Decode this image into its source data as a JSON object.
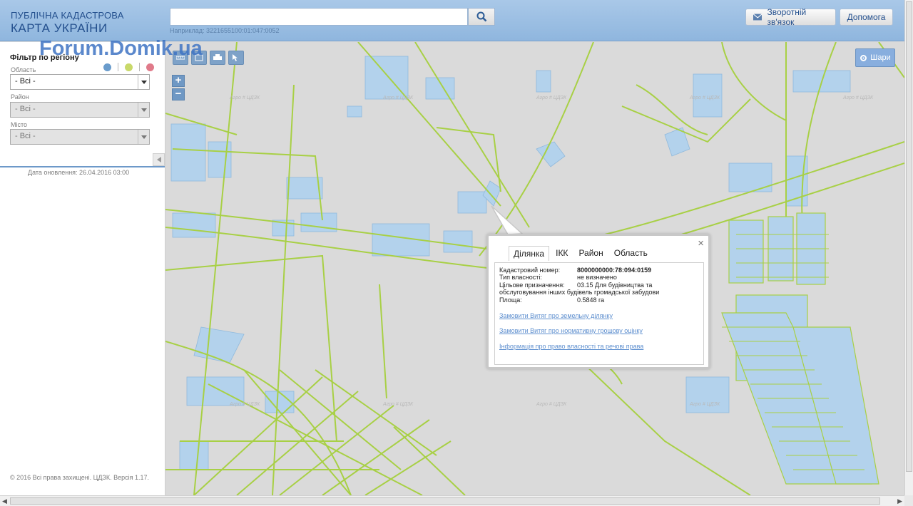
{
  "header": {
    "logo_line1": "ПУБЛІЧНА КАДАСТРОВА",
    "logo_line2": "КАРТА УКРАЇНИ",
    "search_value": "",
    "search_hint": "Наприклад: 3221655100:01:047:0052",
    "feedback_label": "Зворотній зв'язок",
    "help_label": "Допомога"
  },
  "sidebar": {
    "filter_title": "Фільтр по регіону",
    "region_label": "Область",
    "region_value": "- Всі -",
    "district_label": "Район",
    "district_value": "- Всі -",
    "city_label": "Місто",
    "city_value": "- Всі -",
    "update_date": "Дата оновлення: 26.04.2016 03:00",
    "copyright": "© 2016 Всі права захищені. ЦДЗК. Версія 1.17."
  },
  "watermark": "Forum.Domik.ua",
  "map": {
    "layers_label": "Шари",
    "zoom_in": "+",
    "zoom_out": "−",
    "tile_watermark": "Агро # ЦДЗК"
  },
  "popup": {
    "tabs": [
      "Ділянка",
      "ІКК",
      "Район",
      "Область"
    ],
    "active_tab": "Ділянка",
    "rows": [
      {
        "label": "Кадастровий номер:",
        "value": "8000000000:78:094:0159"
      },
      {
        "label": "Тип власності:",
        "value": "не визначено"
      },
      {
        "label": "Цільове призначення:",
        "value": "03.15 Для будівництва та обслуговування інших будівель громадської забудови"
      },
      {
        "label": "Площа:",
        "value": "0.5848 га"
      }
    ],
    "links": [
      "Замовити Витяг про земельну ділянку",
      "Замовити Витяг про нормативну грошову оцінку",
      "Інформація про право власності та речові права"
    ]
  },
  "colors": {
    "header_bg": "#9bbde3",
    "parcel_line": "#a8d045",
    "parcel_fill": "#b3d2ec",
    "map_bg": "#dadada",
    "link": "#5e8fcf",
    "dot_blue": "#6a9ccc",
    "dot_green": "#c9d96a",
    "dot_red": "#e07a8a"
  },
  "icons": [
    "search-icon",
    "envelope-icon",
    "gear-icon",
    "chevron-down-icon",
    "chevron-left-icon",
    "close-icon",
    "ruler-icon",
    "area-icon",
    "print-icon",
    "pointer-query-icon"
  ]
}
